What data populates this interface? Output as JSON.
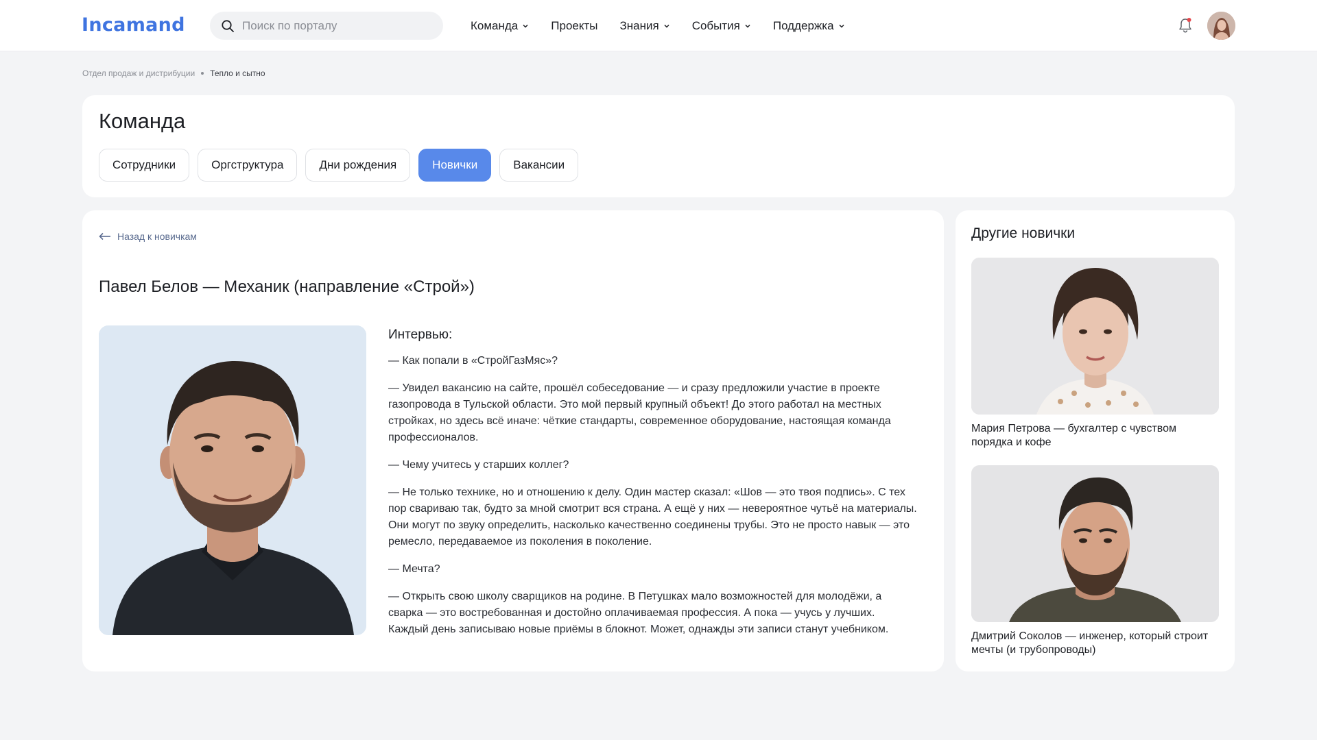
{
  "header": {
    "logo": "Incamand",
    "search_placeholder": "Поиск по порталу",
    "nav": [
      {
        "label": "Команда",
        "has_dropdown": true
      },
      {
        "label": "Проекты",
        "has_dropdown": false
      },
      {
        "label": "Знания",
        "has_dropdown": true
      },
      {
        "label": "События",
        "has_dropdown": true
      },
      {
        "label": "Поддержка",
        "has_dropdown": true
      }
    ]
  },
  "breadcrumb": {
    "first": "Отдел продаж и дистрибуции",
    "current": "Тепло и сытно"
  },
  "team": {
    "title": "Команда",
    "tabs": [
      {
        "label": "Сотрудники",
        "active": false
      },
      {
        "label": "Оргструктура",
        "active": false
      },
      {
        "label": "Дни рождения",
        "active": false
      },
      {
        "label": "Новички",
        "active": true
      },
      {
        "label": "Вакансии",
        "active": false
      }
    ]
  },
  "article": {
    "back_label": "Назад к новичкам",
    "title": "Павел Белов — Механик (направление «Строй»)",
    "interview_heading": "Интервью:",
    "paragraphs": [
      "— Как попали в «СтройГазМяс»?",
      "— Увидел вакансию на сайте, прошёл собеседование — и сразу предложили участие в проекте газопровода в Тульской области. Это мой первый крупный объект! До этого работал на местных стройках, но здесь всё иначе: чёткие стандарты, современное оборудование, настоящая команда профессионалов.",
      "— Чему учитесь у старших коллег?",
      "— Не только технике, но и отношению к делу. Один мастер сказал: «Шов — это твоя подпись». С тех пор свариваю так, будто за мной смотрит вся страна. А ещё у них — невероятное чутьё на материалы. Они могут по звуку определить, насколько качественно соединены трубы. Это не просто навык — это ремесло, передаваемое из поколения в поколение.",
      "— Мечта?",
      "— Открыть свою школу сварщиков на родине. В Петушках мало возможностей для молодёжи, а сварка — это востребованная и достойно оплачиваемая профессия. А пока — учусь у лучших. Каждый день записываю новые приёмы в блокнот. Может, однажды эти записи станут учебником."
    ]
  },
  "sidebar": {
    "title": "Другие новички",
    "items": [
      {
        "caption": "Мария Петрова — бухгалтер с чувством порядка и кофе"
      },
      {
        "caption": "Дмитрий Соколов — инженер, который строит мечты (и трубопроводы)"
      }
    ]
  },
  "colors": {
    "accent": "#5889ea",
    "logo": "#3f74e0",
    "background": "#f3f4f6",
    "notification_dot": "#e5484d"
  },
  "icons": [
    "search-icon",
    "chevron-down-icon",
    "bell-icon",
    "arrow-left-icon"
  ]
}
